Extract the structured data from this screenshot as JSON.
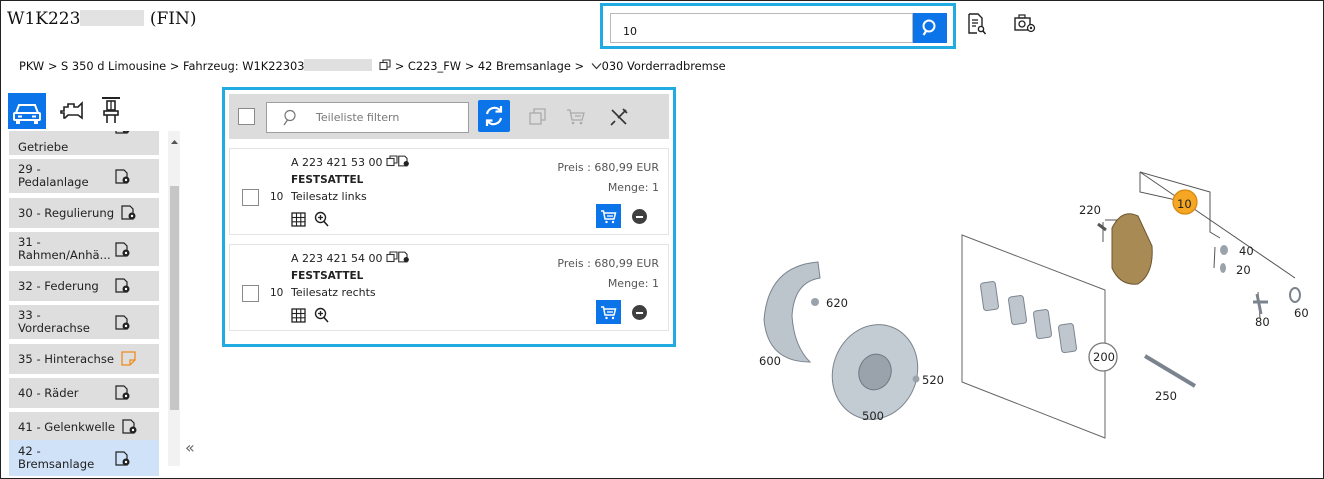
{
  "header": {
    "vin_prefix": "W1K223",
    "vin_suffix": "(FIN)"
  },
  "search": {
    "value": "10"
  },
  "breadcrumb": {
    "part1": "PKW > S 350 d Limousine > Fahrzeug: W1K22303",
    "part2": " > C223_FW  > 42 Bremsanlage >",
    "part3": "030 Vorderradbremse"
  },
  "sidebar": {
    "items": [
      {
        "label_line1": "",
        "label_line2": "Getriebe",
        "top": 0
      },
      {
        "label_line1": "29 -",
        "label_line2": "Pedalanlage"
      },
      {
        "label_line1": "30 - Regulierung",
        "label_line2": ""
      },
      {
        "label_line1": "31 -",
        "label_line2": "Rahmen/Anhä..."
      },
      {
        "label_line1": "32 - Federung",
        "label_line2": ""
      },
      {
        "label_line1": "33 -",
        "label_line2": "Vorderachse"
      },
      {
        "label_line1": "35 - Hinterachse",
        "label_line2": ""
      },
      {
        "label_line1": "40 - Räder",
        "label_line2": ""
      },
      {
        "label_line1": "41 - Gelenkwelle",
        "label_line2": ""
      },
      {
        "label_line1": "42 -",
        "label_line2": "Bremsanlage"
      }
    ],
    "collapse_glyph": "«"
  },
  "parts_panel": {
    "filter_placeholder": "Teileliste filtern",
    "rows": [
      {
        "part_number": "A 223 421 53 00",
        "name": "FESTSATTEL",
        "desc": "Teilesatz links",
        "position": "10",
        "price": "Preis : 680,99 EUR",
        "qty": "Menge: 1"
      },
      {
        "part_number": "A 223 421 54 00",
        "name": "FESTSATTEL",
        "desc": "Teilesatz rechts",
        "position": "10",
        "price": "Preis : 680,99 EUR",
        "qty": "Menge: 1"
      }
    ]
  },
  "diagram": {
    "labels": {
      "l220": "220",
      "l10": "10",
      "l40": "40",
      "l20": "20",
      "l60": "60",
      "l80": "80",
      "l620": "620",
      "l600": "600",
      "l200": "200",
      "l520": "520",
      "l500": "500",
      "l250": "250"
    }
  },
  "colors": {
    "accent": "#0a74e8",
    "highlight_border": "#22aae2",
    "selected_item": "#cfe2f7",
    "callout_highlight": "#f5a623"
  }
}
